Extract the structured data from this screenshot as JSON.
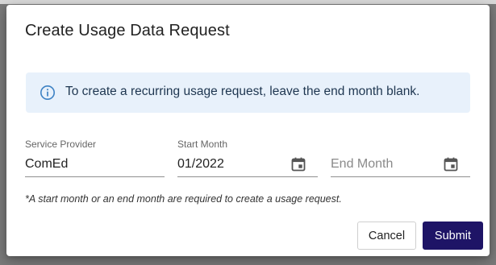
{
  "dialog": {
    "title": "Create Usage Data Request"
  },
  "alert": {
    "icon": "info-icon",
    "message": "To create a recurring usage request, leave the end month blank."
  },
  "form": {
    "service_provider": {
      "label": "Service Provider",
      "value": "ComEd"
    },
    "start_month": {
      "label": "Start Month",
      "value": "01/2022",
      "icon": "calendar-icon"
    },
    "end_month": {
      "placeholder": "End Month",
      "value": "",
      "icon": "calendar-icon"
    }
  },
  "footnote": "*A start month or an end month are required to create a usage request.",
  "actions": {
    "cancel_label": "Cancel",
    "submit_label": "Submit"
  },
  "colors": {
    "primary": "#1e1466",
    "alert_bg": "#e8f1fb",
    "alert_icon": "#3d82c4"
  }
}
